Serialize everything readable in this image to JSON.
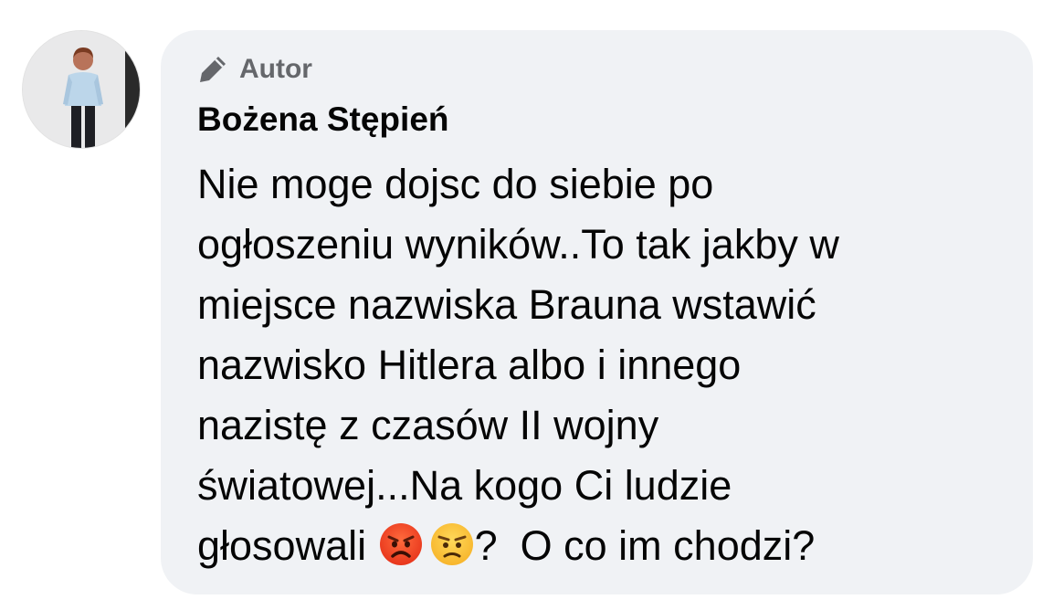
{
  "comment": {
    "author_badge": "Autor",
    "author_badge_icon": "pencil-icon",
    "author_name": "Bożena Stępień",
    "message_lines": [
      "Nie moge dojsc do siebie po",
      "ogłoszeniu wyników..To tak jakby w",
      "miejsce nazwiska Brauna wstawić",
      "nazwisko Hitlera albo i innego",
      "nazistę z czasów II wojny",
      "światowej...Na kogo Ci ludzie"
    ],
    "last_line_start": "głosowali ",
    "last_line_end": "?  O co im chodzi?",
    "emojis": [
      "angry-face-emoji",
      "annoyed-face-emoji"
    ]
  },
  "colors": {
    "bubble_bg": "#f0f2f5",
    "meta_text": "#65676b",
    "text": "#050505"
  }
}
